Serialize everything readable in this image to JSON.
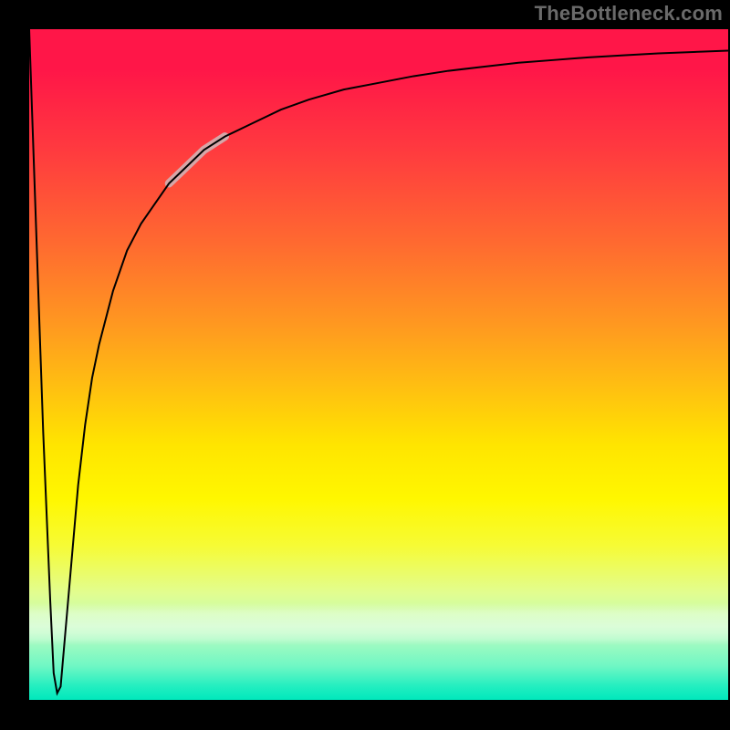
{
  "watermark": {
    "text": "TheBottleneck.com"
  },
  "chart_data": {
    "type": "line",
    "title": "",
    "xlabel": "",
    "ylabel": "",
    "xlim": [
      0,
      100
    ],
    "ylim": [
      0,
      100
    ],
    "grid": false,
    "background_gradient": {
      "direction": "vertical",
      "stops": [
        {
          "pos": 0.0,
          "color": "#ff1648"
        },
        {
          "pos": 0.3,
          "color": "#ff6a30"
        },
        {
          "pos": 0.55,
          "color": "#ffe500"
        },
        {
          "pos": 0.82,
          "color": "#e2fd8f"
        },
        {
          "pos": 1.0,
          "color": "#00e8bc"
        }
      ]
    },
    "highlight_segment": {
      "x_start": 19,
      "x_end": 29,
      "color": "#d6a6a8",
      "width": 9
    },
    "series": [
      {
        "name": "bottleneck-curve",
        "color": "#000000",
        "width": 2,
        "x": [
          0,
          1,
          2,
          3,
          3.5,
          4,
          4.5,
          5,
          6,
          7,
          8,
          9,
          10,
          12,
          14,
          16,
          18,
          20,
          22,
          25,
          28,
          32,
          36,
          40,
          45,
          50,
          55,
          60,
          65,
          70,
          75,
          80,
          85,
          90,
          95,
          100
        ],
        "y": [
          100,
          70,
          40,
          15,
          4,
          1,
          2,
          8,
          20,
          32,
          41,
          48,
          53,
          61,
          67,
          71,
          74,
          77,
          79,
          82,
          84,
          86,
          88,
          89.5,
          91,
          92,
          93,
          93.8,
          94.4,
          95,
          95.4,
          95.8,
          96.1,
          96.4,
          96.6,
          96.8
        ]
      }
    ],
    "annotations": []
  }
}
